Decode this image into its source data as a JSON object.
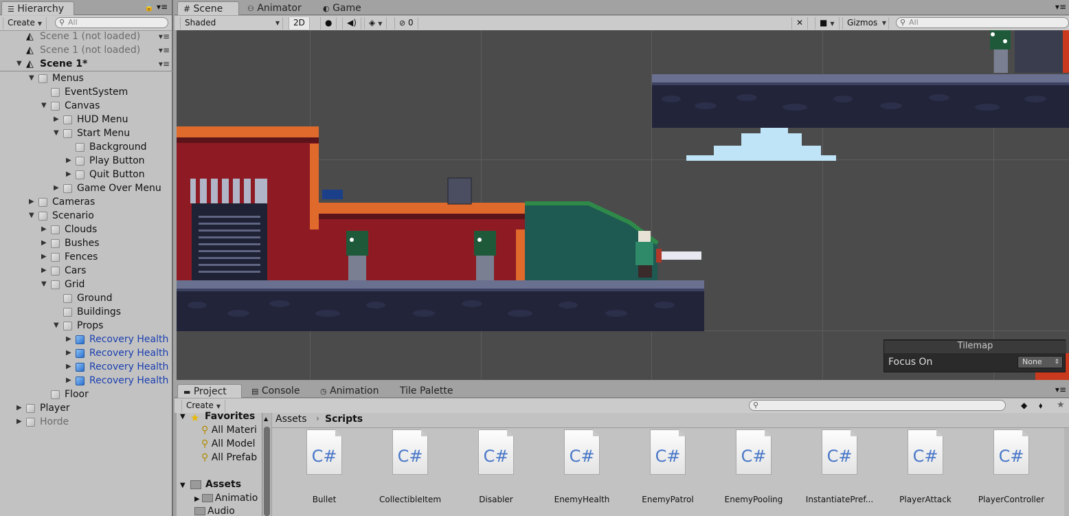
{
  "hierarchy": {
    "tab": "Hierarchy",
    "create": "Create",
    "search_placeholder": "All",
    "rows": [
      {
        "label": "Scene 1 (not loaded)"
      },
      {
        "label": "Scene 1 (not loaded)"
      },
      {
        "label": "Scene 1*"
      },
      {
        "label": "Menus"
      },
      {
        "label": "EventSystem"
      },
      {
        "label": "Canvas"
      },
      {
        "label": "HUD Menu"
      },
      {
        "label": "Start Menu"
      },
      {
        "label": "Background"
      },
      {
        "label": "Play Button"
      },
      {
        "label": "Quit Button"
      },
      {
        "label": "Game Over Menu"
      },
      {
        "label": "Cameras"
      },
      {
        "label": "Scenario"
      },
      {
        "label": "Clouds"
      },
      {
        "label": "Bushes"
      },
      {
        "label": "Fences"
      },
      {
        "label": "Cars"
      },
      {
        "label": "Grid"
      },
      {
        "label": "Ground"
      },
      {
        "label": "Buildings"
      },
      {
        "label": "Props"
      },
      {
        "label": "Recovery Health"
      },
      {
        "label": "Recovery Health"
      },
      {
        "label": "Recovery Health"
      },
      {
        "label": "Recovery Health"
      },
      {
        "label": "Floor"
      },
      {
        "label": "Player"
      },
      {
        "label": "Horde"
      }
    ]
  },
  "scene_tabs": {
    "scene": "Scene",
    "animator": "Animator",
    "game": "Game"
  },
  "scene_toolbar": {
    "shading": "Shaded",
    "mode_2d": "2D",
    "hidden_count": "0",
    "gizmos": "Gizmos",
    "search_placeholder": "All"
  },
  "tilemap_overlay": {
    "title": "Tilemap",
    "focus_label": "Focus On",
    "focus_value": "None"
  },
  "bottom_tabs": {
    "project": "Project",
    "console": "Console",
    "animation": "Animation",
    "tile_palette": "Tile Palette"
  },
  "project": {
    "create": "Create",
    "breadcrumb_root": "Assets",
    "breadcrumb_current": "Scripts",
    "favorites": "Favorites",
    "favorite_items": [
      "All Materi",
      "All Model",
      "All Prefab"
    ],
    "assets_label": "Assets",
    "asset_folders": [
      "Animatio",
      "Audio"
    ],
    "files": [
      {
        "name": "Bullet",
        "type": "C#"
      },
      {
        "name": "CollectibleItem",
        "type": "C#"
      },
      {
        "name": "Disabler",
        "type": "C#"
      },
      {
        "name": "EnemyHealth",
        "type": "C#"
      },
      {
        "name": "EnemyPatrol",
        "type": "C#"
      },
      {
        "name": "EnemyPooling",
        "type": "C#"
      },
      {
        "name": "InstantiatePref...",
        "type": "C#"
      },
      {
        "name": "PlayerAttack",
        "type": "C#"
      },
      {
        "name": "PlayerController",
        "type": "C#"
      }
    ]
  },
  "colors": {
    "panel": "#c2c2c2",
    "scene_bg": "#4b4b4b",
    "selected_text": "#1a3fb0",
    "cs_icon": "#4a78c8"
  }
}
